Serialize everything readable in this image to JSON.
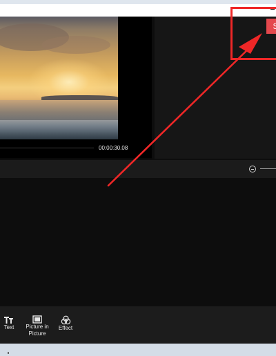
{
  "preview": {
    "timecode": "00:00:30.08",
    "playback_progress": 0.0
  },
  "header": {
    "export_label": "S"
  },
  "toolbar": {
    "zoom_out_icon": "zoom-out-icon"
  },
  "bottom_tools": [
    {
      "label": "Text",
      "icon": "text-icon"
    },
    {
      "label": "Picture in Picture",
      "icon": "picture-in-picture-icon"
    },
    {
      "label": "Effect",
      "icon": "effect-icon"
    }
  ],
  "annotation": {
    "color": "#ef2727"
  },
  "colors": {
    "accent": "#e5484d",
    "panel_bg": "#161616",
    "app_bg": "#0d0d0d"
  }
}
